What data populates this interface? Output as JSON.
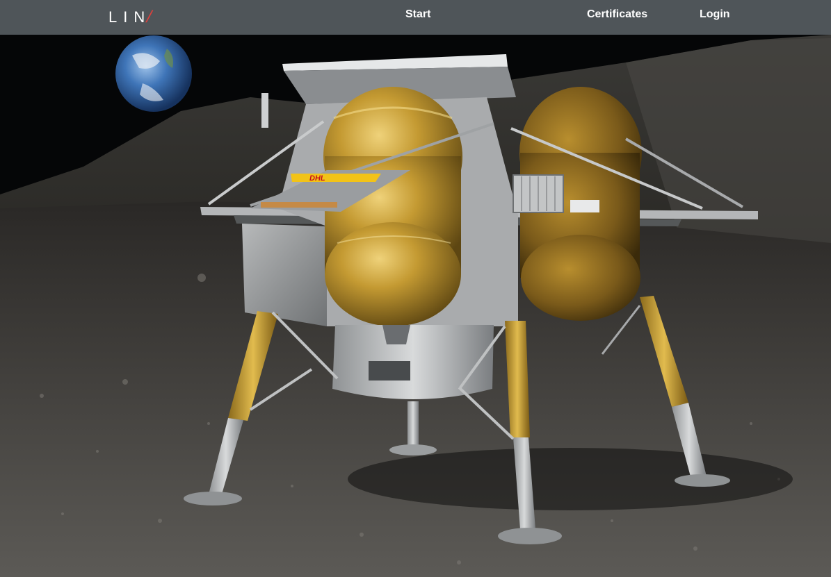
{
  "header": {
    "logo_text": "LIN",
    "nav": {
      "start": "Start",
      "certificates": "Certificates",
      "login": "Login"
    }
  },
  "hero": {
    "badge_text": "DHL",
    "colors": {
      "navbar": "#4f5559",
      "logo_accent": "#e0403c",
      "foil": "#c9a43c",
      "badge": "#f2c318"
    }
  }
}
